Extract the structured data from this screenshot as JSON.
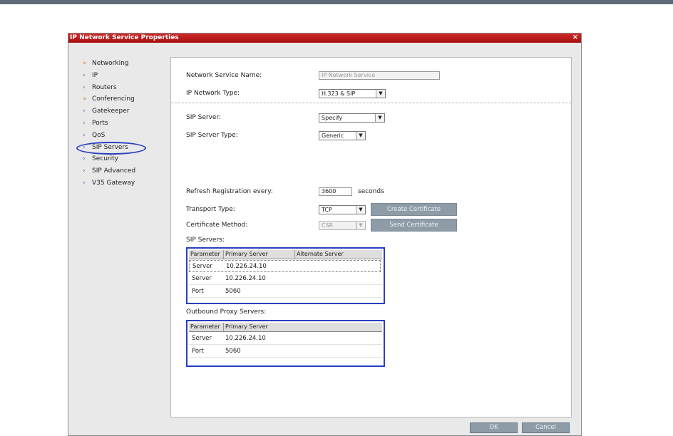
{
  "window": {
    "title": "IP Network Service Properties",
    "close_glyph": "×"
  },
  "nav": {
    "items": [
      {
        "label": "Networking",
        "icon": "double-chevron-icon"
      },
      {
        "label": "IP",
        "icon": "chevron-icon"
      },
      {
        "label": "Routers",
        "icon": "chevron-icon"
      },
      {
        "label": "Conferencing",
        "icon": "double-chevron-icon"
      },
      {
        "label": "Gatekeeper",
        "icon": "chevron-icon"
      },
      {
        "label": "Ports",
        "icon": "chevron-icon"
      },
      {
        "label": "QoS",
        "icon": "chevron-icon"
      },
      {
        "label": "SIP Servers",
        "icon": "chevron-icon"
      },
      {
        "label": "Security",
        "icon": "chevron-icon"
      },
      {
        "label": "SIP Advanced",
        "icon": "chevron-icon"
      },
      {
        "label": "V35 Gateway",
        "icon": "chevron-icon"
      }
    ],
    "selected": "SIP Servers"
  },
  "form": {
    "service_name_label": "Network Service Name:",
    "service_name_value": "IP Network Service",
    "network_type_label": "IP Network Type:",
    "network_type_value": "H.323 & SIP",
    "sip_server_label": "SIP Server:",
    "sip_server_value": "Specify",
    "sip_server_type_label": "SIP Server Type:",
    "sip_server_type_value": "Generic",
    "refresh_label": "Refresh Registration every:",
    "refresh_value": "3600",
    "refresh_unit": "seconds",
    "transport_label": "Transport Type:",
    "transport_value": "TCP",
    "create_cert_label": "Create Certificate",
    "cert_method_label": "Certificate Method:",
    "cert_method_value": "CSR",
    "send_cert_label": "Send Certificate"
  },
  "sip_servers": {
    "caption": "SIP Servers:",
    "headers": [
      "Parameter",
      "Primary Server",
      "Alternate Server"
    ],
    "rows": [
      [
        "Server",
        "10.226.24.10",
        ""
      ],
      [
        "Server",
        "10.226.24.10",
        ""
      ],
      [
        "Port",
        "5060",
        ""
      ]
    ]
  },
  "proxy_servers": {
    "caption": "Outbound Proxy Servers:",
    "headers": [
      "Parameter",
      "Primary Server"
    ],
    "rows": [
      [
        "Server",
        "10.226.24.10"
      ],
      [
        "Port",
        "5060"
      ]
    ]
  },
  "footer": {
    "ok_label": "OK",
    "cancel_label": "Cancel"
  },
  "colors": {
    "title_bar": "#b81818",
    "highlight": "#2a3fbf",
    "button": "#8e9ca8"
  }
}
